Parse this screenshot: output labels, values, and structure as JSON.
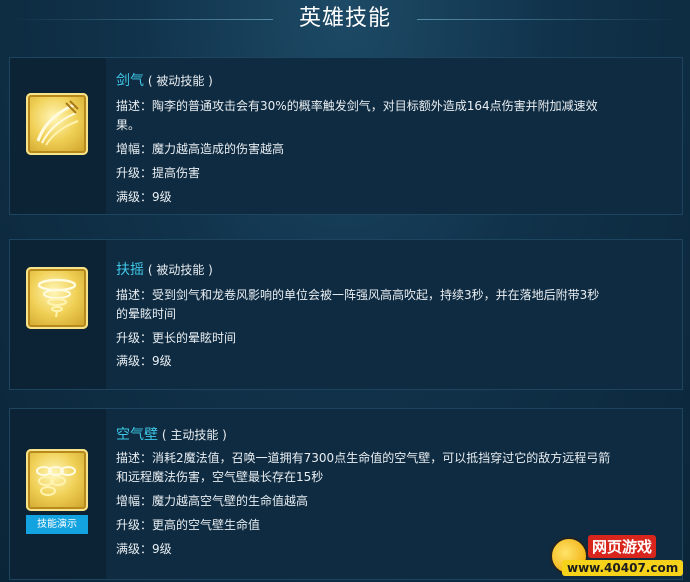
{
  "page": {
    "title": "英雄技能"
  },
  "skills": [
    {
      "name": "剑气",
      "type": "( 被动技能 )",
      "icon": "sword-slash-icon",
      "rows": [
        {
          "label": "描述：",
          "value": "陶李的普通攻击会有30%的概率触发剑气，对目标额外造成164点伤害并附加减速效",
          "cont": "果。"
        },
        {
          "label": "增幅：",
          "value": "魔力越高造成的伤害越高"
        },
        {
          "label": "升级：",
          "value": "提高伤害"
        },
        {
          "label": "满级：",
          "value": "9级"
        }
      ]
    },
    {
      "name": "扶摇",
      "type": "( 被动技能 )",
      "icon": "tornado-icon",
      "rows": [
        {
          "label": "描述：",
          "value": "受到剑气和龙卷风影响的单位会被一阵强风高高吹起，持续3秒，并在落地后附带3秒",
          "cont": "的晕眩时间"
        },
        {
          "label": "升级：",
          "value": "更长的晕眩时间"
        },
        {
          "label": "满级：",
          "value": "9级"
        }
      ]
    },
    {
      "name": "空气壁",
      "type": "( 主动技能 )",
      "icon": "air-wall-icon",
      "demo_button": "技能演示",
      "rows": [
        {
          "label": "描述：",
          "value": "消耗2魔法值，召唤一道拥有7300点生命值的空气壁，可以抵挡穿过它的敌方远程弓箭",
          "cont": "和远程魔法伤害，空气壁最长存在15秒"
        },
        {
          "label": "增幅：",
          "value": "魔力越高空气壁的生命值越高"
        },
        {
          "label": "升级：",
          "value": "更高的空气壁生命值"
        },
        {
          "label": "满级：",
          "value": "9级"
        }
      ]
    }
  ],
  "watermark": {
    "line1": "网页游戏",
    "line2": "www.40407.com"
  },
  "colors": {
    "skill_name": "#3fc8e8",
    "demo_button": "#13a3e0",
    "background": "#10324a"
  }
}
